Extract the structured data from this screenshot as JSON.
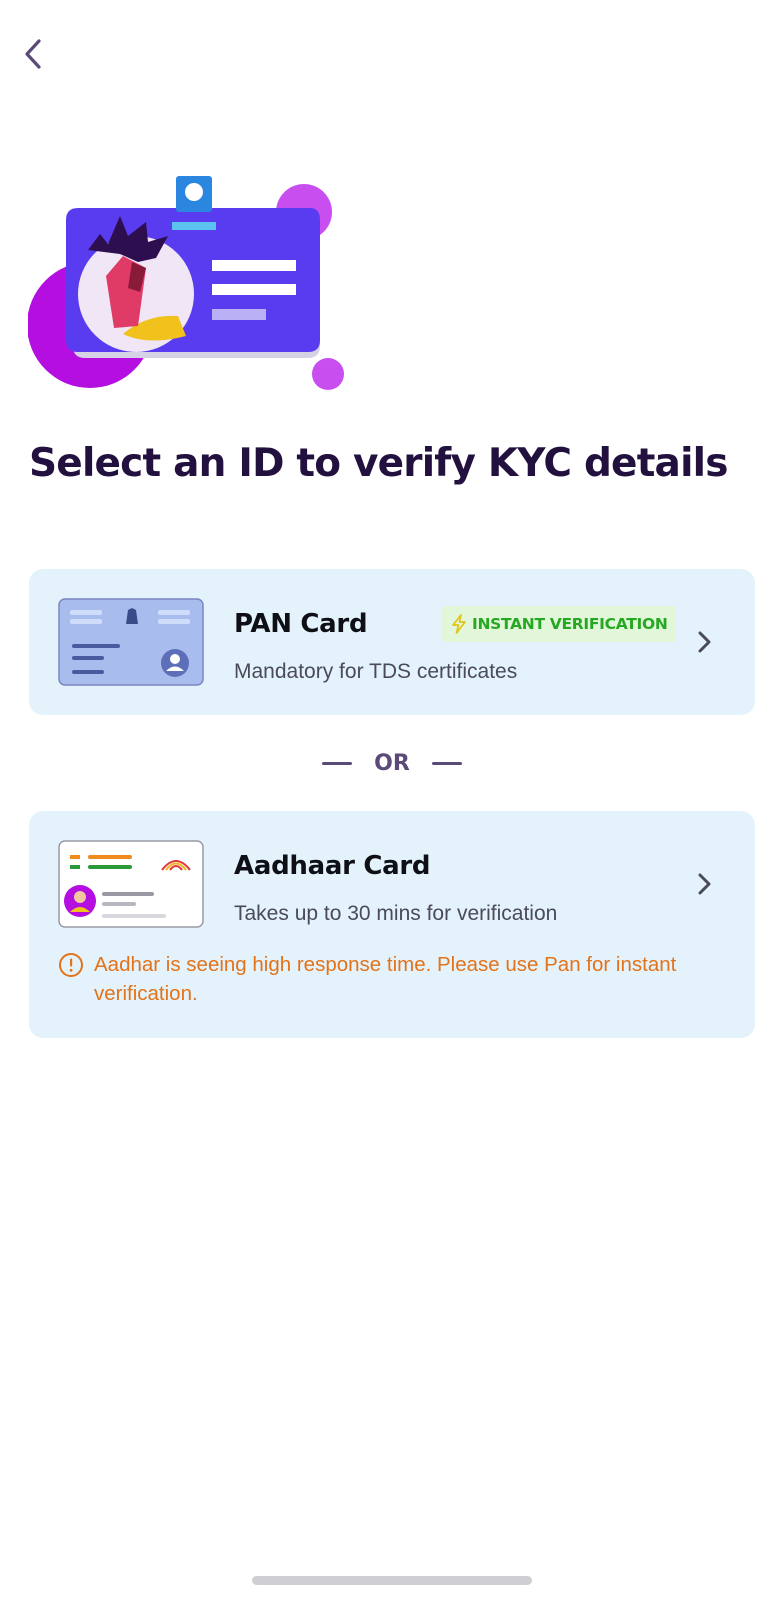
{
  "header": {
    "back_icon": "chevron-left-icon"
  },
  "hero": {
    "illustration": "id-card-illustration"
  },
  "page": {
    "title": "Select an ID to verify KYC details"
  },
  "options": {
    "pan": {
      "title": "PAN Card",
      "subtitle": "Mandatory for TDS certificates",
      "badge": "INSTANT VERIFICATION",
      "badge_icon": "lightning-icon",
      "chevron_icon": "chevron-right-icon"
    },
    "divider": "OR",
    "aadhaar": {
      "title": "Aadhaar Card",
      "subtitle": "Takes up to 30 mins for verification",
      "warning": "Aadhar is seeing high response time. Please use Pan for instant verification.",
      "warning_icon": "alert-circle-icon",
      "chevron_icon": "chevron-right-icon"
    }
  },
  "colors": {
    "title": "#22103f",
    "card_bg": "#e4f3fb",
    "badge_bg": "#e2f7da",
    "badge_text": "#27a822",
    "warning": "#e2731a",
    "accent_purple": "#5b3df5",
    "accent_magenta": "#c51ee0"
  }
}
